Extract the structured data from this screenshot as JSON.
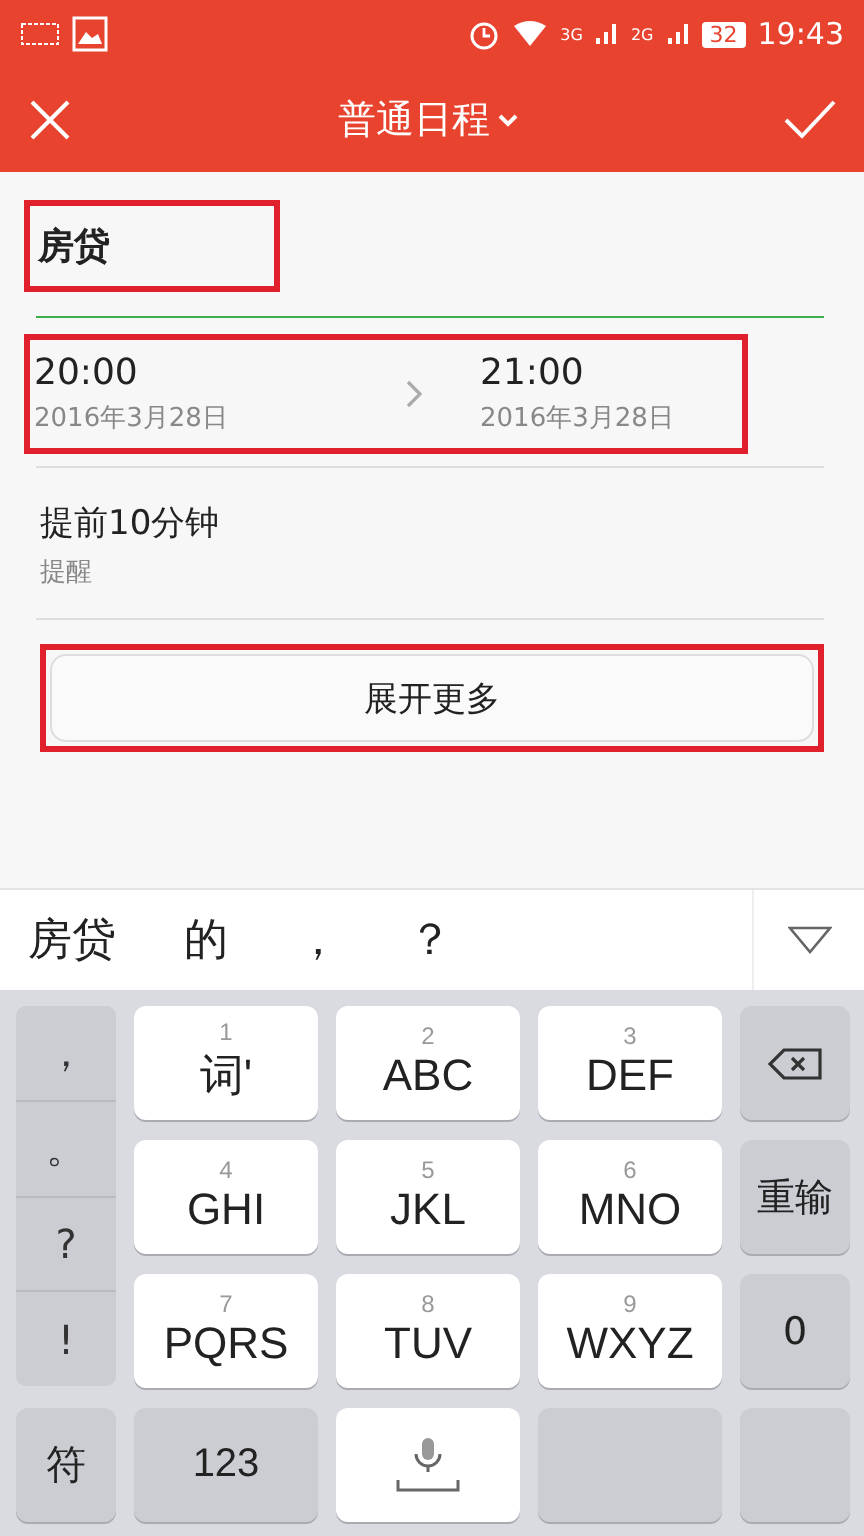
{
  "status_bar": {
    "network_1": "3G",
    "network_2": "2G",
    "battery": "32",
    "time": "19:43"
  },
  "header": {
    "title": "普通日程"
  },
  "form": {
    "title_field": {
      "value": "房贷",
      "highlighted": true
    },
    "time_range": {
      "highlighted": true,
      "start": {
        "time": "20:00",
        "date": "2016年3月28日"
      },
      "end": {
        "time": "21:00",
        "date": "2016年3月28日"
      }
    },
    "reminder": {
      "value": "提前10分钟",
      "label": "提醒"
    },
    "expand_button": {
      "label": "展开更多",
      "highlighted": true
    }
  },
  "candidates": [
    "房贷",
    "的",
    "，",
    "？"
  ],
  "keyboard": {
    "punctuation": [
      "，",
      "。",
      "?",
      "!"
    ],
    "keys": [
      {
        "digit": "1",
        "letters": "词'"
      },
      {
        "digit": "2",
        "letters": "ABC"
      },
      {
        "digit": "3",
        "letters": "DEF"
      },
      {
        "digit": "4",
        "letters": "GHI"
      },
      {
        "digit": "5",
        "letters": "JKL"
      },
      {
        "digit": "6",
        "letters": "MNO"
      },
      {
        "digit": "7",
        "letters": "PQRS"
      },
      {
        "digit": "8",
        "letters": "TUV"
      },
      {
        "digit": "9",
        "letters": "WXYZ"
      }
    ],
    "side_keys": [
      {
        "kind": "backspace"
      },
      {
        "kind": "text",
        "label": "重输"
      },
      {
        "kind": "text",
        "label": "0"
      }
    ],
    "bottom_row": [
      {
        "kind": "text",
        "label": "符"
      },
      {
        "kind": "text",
        "label": "123"
      },
      {
        "kind": "space"
      },
      {
        "kind": "blank"
      },
      {
        "kind": "blank"
      }
    ]
  }
}
